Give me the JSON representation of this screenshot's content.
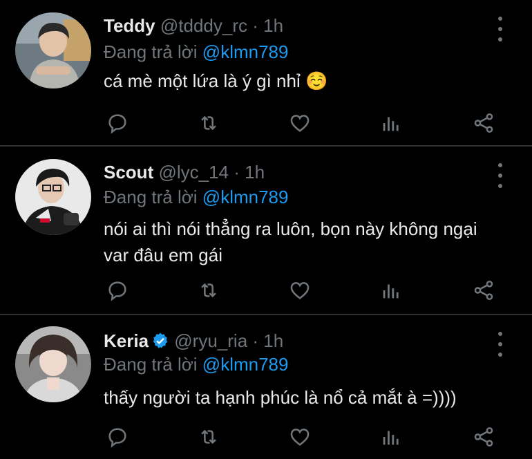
{
  "reply_prefix": "Đang trả lời",
  "tweets": [
    {
      "name": "Teddy",
      "handle": "@tdddy_rc",
      "sep": "·",
      "time": "1h",
      "reply_to": "@klmn789",
      "text": "cá mè một lứa là ý gì nhỉ ☺️",
      "verified": false
    },
    {
      "name": "Scout",
      "handle": "@lyc_14",
      "sep": "·",
      "time": "1h",
      "reply_to": "@klmn789",
      "text": "nói ai thì nói thẳng ra luôn, bọn này không ngại var đâu em gái",
      "verified": false
    },
    {
      "name": "Keria",
      "handle": "@ryu_ria",
      "sep": "·",
      "time": "1h",
      "reply_to": "@klmn789",
      "text": "thấy người ta hạnh phúc là nổ cả mắt à =))))",
      "verified": true
    }
  ],
  "icons": {
    "reply": "reply-icon",
    "retweet": "retweet-icon",
    "like": "like-icon",
    "analytics": "analytics-icon",
    "share": "share-icon",
    "more": "more-options-icon"
  },
  "colors": {
    "background": "#000000",
    "text": "#e7e9ea",
    "muted": "#71767b",
    "accent": "#1d9bf0"
  }
}
